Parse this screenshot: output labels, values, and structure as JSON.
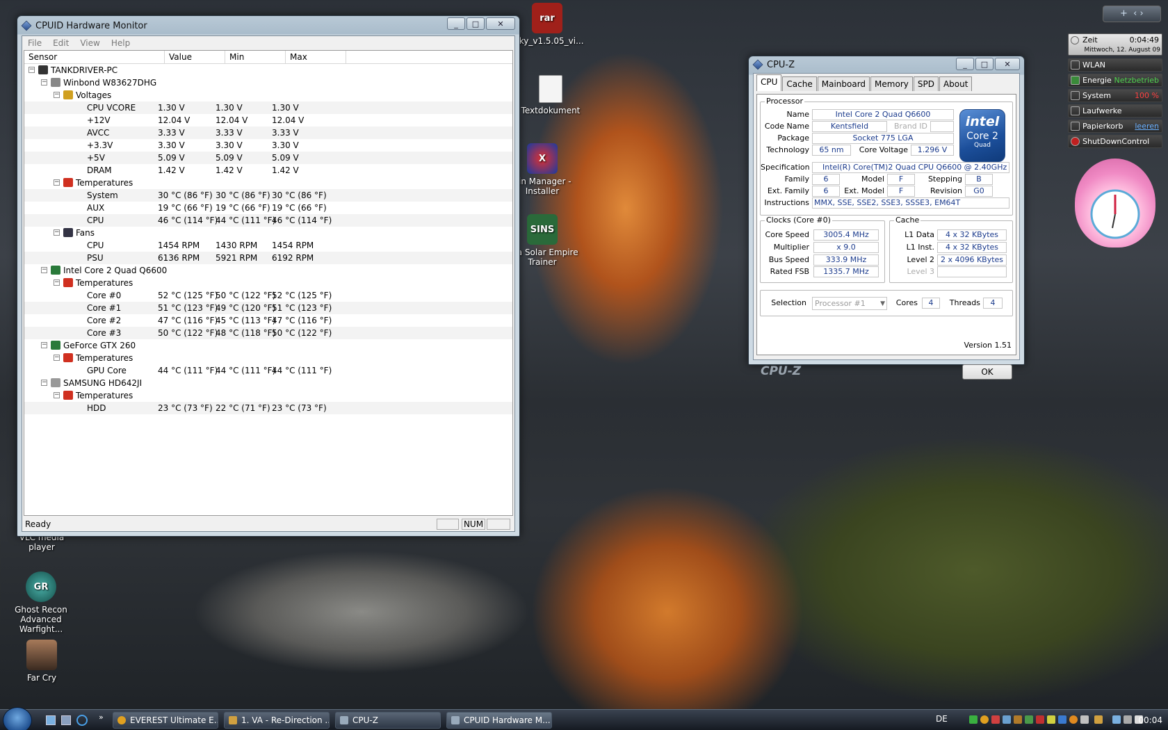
{
  "hwmonitor": {
    "title": "CPUID Hardware Monitor",
    "menu": [
      "File",
      "Edit",
      "View",
      "Help"
    ],
    "columns": [
      "Sensor",
      "Value",
      "Min",
      "Max"
    ],
    "rows": [
      {
        "level": 0,
        "type": "node",
        "name": "TANKDRIVER-PC",
        "icon": "computer-icon"
      },
      {
        "level": 1,
        "type": "node",
        "name": "Winbond W83627DHG",
        "icon": "chip-icon"
      },
      {
        "level": 2,
        "type": "node",
        "name": "Voltages",
        "icon": "voltage-icon"
      },
      {
        "level": 3,
        "type": "leaf",
        "name": "CPU VCORE",
        "value": "1.30 V",
        "min": "1.30 V",
        "max": "1.30 V"
      },
      {
        "level": 3,
        "type": "leaf",
        "name": "+12V",
        "value": "12.04 V",
        "min": "12.04 V",
        "max": "12.04 V"
      },
      {
        "level": 3,
        "type": "leaf",
        "name": "AVCC",
        "value": "3.33 V",
        "min": "3.33 V",
        "max": "3.33 V"
      },
      {
        "level": 3,
        "type": "leaf",
        "name": "+3.3V",
        "value": "3.30 V",
        "min": "3.30 V",
        "max": "3.30 V"
      },
      {
        "level": 3,
        "type": "leaf",
        "name": "+5V",
        "value": "5.09 V",
        "min": "5.09 V",
        "max": "5.09 V"
      },
      {
        "level": 3,
        "type": "leaf",
        "name": "DRAM",
        "value": "1.42 V",
        "min": "1.42 V",
        "max": "1.42 V"
      },
      {
        "level": 2,
        "type": "node",
        "name": "Temperatures",
        "icon": "thermometer-icon"
      },
      {
        "level": 3,
        "type": "leaf",
        "name": "System",
        "value": "30 °C  (86 °F)",
        "min": "30 °C  (86 °F)",
        "max": "30 °C  (86 °F)"
      },
      {
        "level": 3,
        "type": "leaf",
        "name": "AUX",
        "value": "19 °C  (66 °F)",
        "min": "19 °C  (66 °F)",
        "max": "19 °C  (66 °F)"
      },
      {
        "level": 3,
        "type": "leaf",
        "name": "CPU",
        "value": "46 °C  (114 °F)",
        "min": "44 °C  (111 °F)",
        "max": "46 °C  (114 °F)"
      },
      {
        "level": 2,
        "type": "node",
        "name": "Fans",
        "icon": "fan-icon"
      },
      {
        "level": 3,
        "type": "leaf",
        "name": "CPU",
        "value": "1454 RPM",
        "min": "1430 RPM",
        "max": "1454 RPM"
      },
      {
        "level": 3,
        "type": "leaf",
        "name": "PSU",
        "value": "6136 RPM",
        "min": "5921 RPM",
        "max": "6192 RPM"
      },
      {
        "level": 1,
        "type": "node",
        "name": "Intel Core 2 Quad Q6600",
        "icon": "cpu-icon"
      },
      {
        "level": 2,
        "type": "node",
        "name": "Temperatures",
        "icon": "thermometer-icon"
      },
      {
        "level": 3,
        "type": "leaf",
        "name": "Core #0",
        "value": "52 °C  (125 °F)",
        "min": "50 °C  (122 °F)",
        "max": "52 °C  (125 °F)"
      },
      {
        "level": 3,
        "type": "leaf",
        "name": "Core #1",
        "value": "51 °C  (123 °F)",
        "min": "49 °C  (120 °F)",
        "max": "51 °C  (123 °F)"
      },
      {
        "level": 3,
        "type": "leaf",
        "name": "Core #2",
        "value": "47 °C  (116 °F)",
        "min": "45 °C  (113 °F)",
        "max": "47 °C  (116 °F)"
      },
      {
        "level": 3,
        "type": "leaf",
        "name": "Core #3",
        "value": "50 °C  (122 °F)",
        "min": "48 °C  (118 °F)",
        "max": "50 °C  (122 °F)"
      },
      {
        "level": 1,
        "type": "node",
        "name": "GeForce GTX 260",
        "icon": "gpu-icon"
      },
      {
        "level": 2,
        "type": "node",
        "name": "Temperatures",
        "icon": "thermometer-icon"
      },
      {
        "level": 3,
        "type": "leaf",
        "name": "GPU Core",
        "value": "44 °C  (111 °F)",
        "min": "44 °C  (111 °F)",
        "max": "44 °C  (111 °F)"
      },
      {
        "level": 1,
        "type": "node",
        "name": "SAMSUNG HD642JI",
        "icon": "hdd-icon"
      },
      {
        "level": 2,
        "type": "node",
        "name": "Temperatures",
        "icon": "thermometer-icon"
      },
      {
        "level": 3,
        "type": "leaf",
        "name": "HDD",
        "value": "23 °C  (73 °F)",
        "min": "22 °C  (71 °F)",
        "max": "23 °C  (73 °F)"
      }
    ],
    "status": "Ready",
    "num": "NUM"
  },
  "cpuz": {
    "title": "CPU-Z",
    "tabs": [
      "CPU",
      "Cache",
      "Mainboard",
      "Memory",
      "SPD",
      "About"
    ],
    "processor": {
      "group": "Processor",
      "name_label": "Name",
      "name": "Intel Core 2 Quad Q6600",
      "codename_label": "Code Name",
      "codename": "Kentsfield",
      "brandid_label": "Brand ID",
      "package_label": "Package",
      "package": "Socket 775 LGA",
      "tech_label": "Technology",
      "tech": "65 nm",
      "voltage_label": "Core Voltage",
      "voltage": "1.296 V",
      "spec_label": "Specification",
      "spec": "Intel(R) Core(TM)2 Quad CPU    Q6600  @ 2.40GHz",
      "family_label": "Family",
      "family": "6",
      "model_label": "Model",
      "model": "F",
      "stepping_label": "Stepping",
      "stepping": "B",
      "extfamily_label": "Ext. Family",
      "extfamily": "6",
      "extmodel_label": "Ext. Model",
      "extmodel": "F",
      "revision_label": "Revision",
      "revision": "G0",
      "instr_label": "Instructions",
      "instr": "MMX, SSE, SSE2, SSE3, SSSE3, EM64T"
    },
    "logo": {
      "brand": "intel",
      "product": "Core 2",
      "sub": "Quad"
    },
    "clocks": {
      "group": "Clocks (Core #0)",
      "speed_label": "Core Speed",
      "speed": "3005.4 MHz",
      "mult_label": "Multiplier",
      "mult": "x 9.0",
      "bus_label": "Bus Speed",
      "bus": "333.9 MHz",
      "fsb_label": "Rated FSB",
      "fsb": "1335.7 MHz"
    },
    "cache": {
      "group": "Cache",
      "l1d_label": "L1 Data",
      "l1d": "4 x 32 KBytes",
      "l1i_label": "L1 Inst.",
      "l1i": "4 x 32 KBytes",
      "l2_label": "Level 2",
      "l2": "2 x 4096 KBytes",
      "l3_label": "Level 3"
    },
    "selection_label": "Selection",
    "selection": "Processor #1",
    "cores_label": "Cores",
    "cores": "4",
    "threads_label": "Threads",
    "threads": "4",
    "version": "Version 1.51",
    "footer_logo": "CPU-Z",
    "ok": "OK"
  },
  "desktop_icons": [
    {
      "label": "Textdokument",
      "label2": ""
    },
    {
      "label": "gin Manager -",
      "label2": "Installer"
    },
    {
      "label": "of a Solar Empire",
      "label2": "Trainer"
    },
    {
      "label": "VLC media player",
      "label2": ""
    },
    {
      "label": "Ghost Recon",
      "label2": "Advanced Warfight..."
    },
    {
      "label": "Far Cry",
      "label2": ""
    },
    {
      "label": "_sky_v1.5.05_vi...",
      "label2": ""
    }
  ],
  "sidebar": {
    "time_label": "Zeit",
    "time": "0:04:49",
    "date": "Mittwoch, 12. August 09",
    "items": [
      {
        "label": "WLAN",
        "value": ""
      },
      {
        "label": "Energie",
        "value": "Netzbetrieb"
      },
      {
        "label": "System",
        "value": "100 %"
      },
      {
        "label": "Laufwerke",
        "value": ""
      },
      {
        "label": "Papierkorb",
        "value": "leeren"
      },
      {
        "label": "ShutDownControl",
        "value": ""
      }
    ]
  },
  "taskbar": {
    "buttons": [
      "EVEREST Ultimate E...",
      "1. VA - Re-Direction ...",
      "CPU-Z",
      "CPUID Hardware M..."
    ],
    "lang": "DE",
    "clock": "00:04"
  },
  "colors": {
    "accent": "#1a3a8c",
    "energie": "#4fd24f",
    "system": "#ff4040"
  }
}
